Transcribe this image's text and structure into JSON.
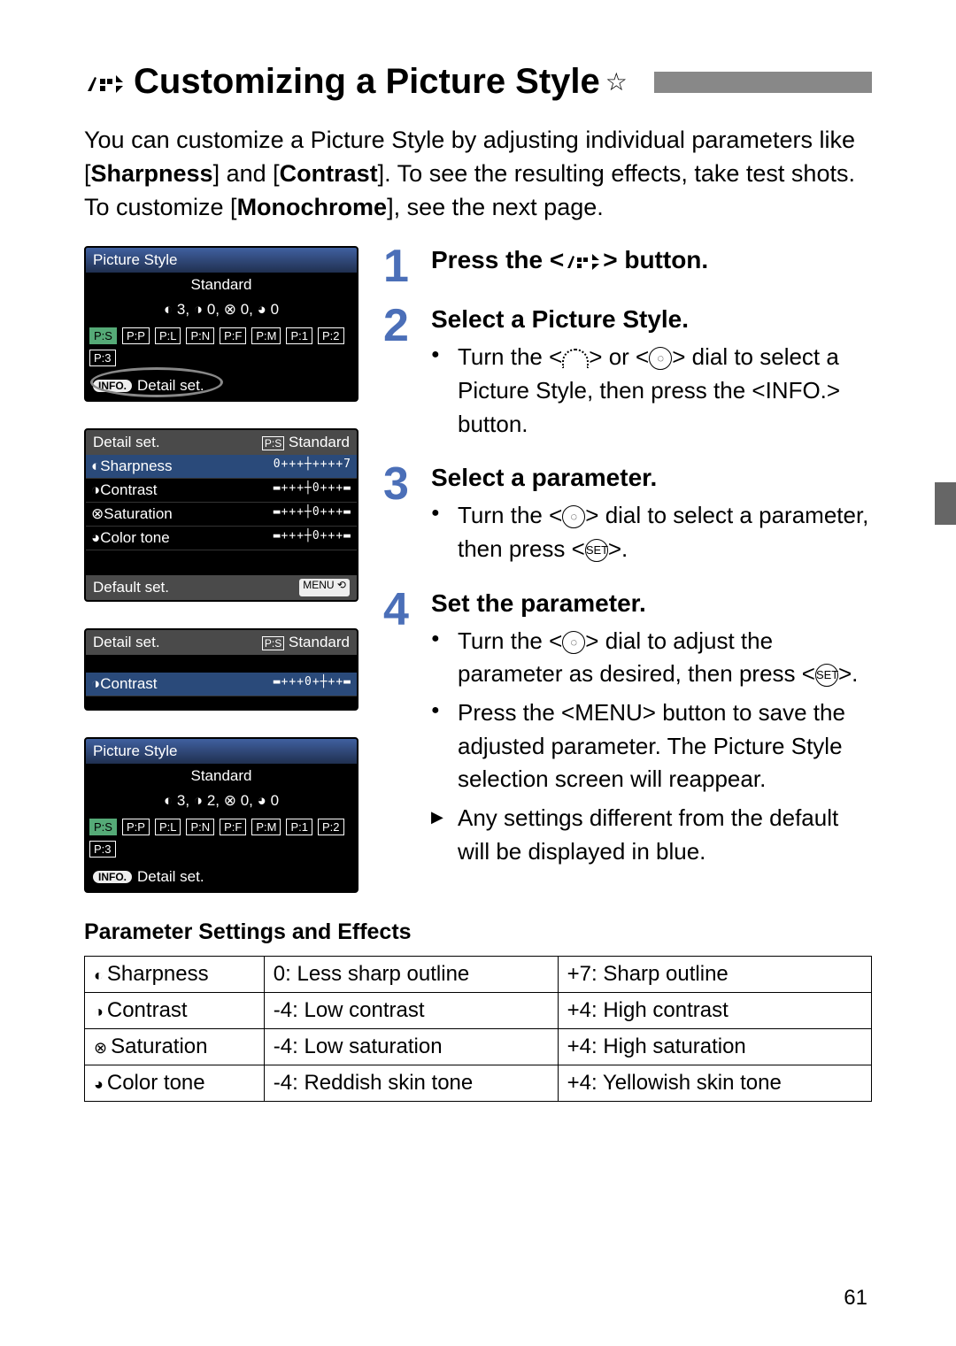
{
  "title": "Customizing a Picture Style",
  "star": "☆",
  "intro_parts": [
    "You can customize a Picture Style by adjusting individual parameters like [",
    "Sharpness",
    "] and [",
    "Contrast",
    "]. To see the resulting effects, take test shots. To customize [",
    "Monochrome",
    "], see the next page."
  ],
  "steps": [
    {
      "num": "1",
      "title_pre": "Press the <",
      "title_post": "> button.",
      "items": []
    },
    {
      "num": "2",
      "title": "Select a Picture Style.",
      "items": [
        {
          "kind": "bullet",
          "frags": [
            "Turn the <",
            "@DIAL",
            "> or <",
            "@CIRCLE",
            "> dial to select a Picture Style, then press the <",
            "INFO.",
            "> button."
          ]
        }
      ]
    },
    {
      "num": "3",
      "title": "Select a parameter.",
      "items": [
        {
          "kind": "bullet",
          "frags": [
            "Turn the <",
            "@CIRCLE",
            "> dial to select a parameter, then press <",
            "@SET",
            ">."
          ]
        }
      ]
    },
    {
      "num": "4",
      "title": "Set the parameter.",
      "items": [
        {
          "kind": "bullet",
          "frags": [
            "Turn the <",
            "@CIRCLE",
            "> dial to adjust the parameter as desired, then press <",
            "@SET",
            ">."
          ]
        },
        {
          "kind": "bullet",
          "frags": [
            "Press the <",
            "MENU",
            "> button to save the adjusted parameter. The Picture Style selection screen will reappear."
          ]
        },
        {
          "kind": "tri",
          "frags": [
            "Any settings different from the default will be displayed in blue."
          ]
        }
      ]
    }
  ],
  "lcd1": {
    "title": "Picture Style",
    "subtitle": "Standard",
    "readout": "◐ 3, ◑ 0, ⊗ 0, ◕ 0",
    "chips": [
      "P:S",
      "P:P",
      "P:L",
      "P:N",
      "P:F",
      "P:M",
      "P:1",
      "P:2",
      "P:3"
    ],
    "footer_info": "INFO.",
    "footer_text": "Detail set."
  },
  "lcd2": {
    "hdr_left": "Detail set.",
    "hdr_right": "P:S Standard",
    "rows": [
      {
        "label": "◐Sharpness",
        "slider": "0+++┼++++7",
        "sel": true
      },
      {
        "label": "◑Contrast",
        "slider": "▬+++┼0+++▬"
      },
      {
        "label": "⊗Saturation",
        "slider": "▬+++┼0+++▬"
      },
      {
        "label": "◕Color tone",
        "slider": "▬+++┼0+++▬"
      }
    ],
    "default": "Default set.",
    "menu": "MENU ⟲"
  },
  "lcd3": {
    "hdr_left": "Detail set.",
    "hdr_right": "P:S Standard",
    "row": {
      "label": "◑Contrast",
      "slider": "▬+++0+┼++▬"
    }
  },
  "lcd4": {
    "title": "Picture Style",
    "subtitle": "Standard",
    "readout": "◐ 3, ◑ 2, ⊗ 0, ◕ 0",
    "chips": [
      "P:S",
      "P:P",
      "P:L",
      "P:N",
      "P:F",
      "P:M",
      "P:1",
      "P:2",
      "P:3"
    ],
    "footer_info": "INFO.",
    "footer_text": "Detail set."
  },
  "table_title": "Parameter Settings and Effects",
  "table": [
    {
      "icon": "◐",
      "name": "Sharpness",
      "low": "0: Less sharp outline",
      "high": "+7: Sharp outline"
    },
    {
      "icon": "◑",
      "name": "Contrast",
      "low": "-4: Low contrast",
      "high": "+4: High contrast"
    },
    {
      "icon": "⊗",
      "name": "Saturation",
      "low": "-4: Low saturation",
      "high": "+4: High saturation"
    },
    {
      "icon": "◕",
      "name": "Color tone",
      "low": "-4: Reddish skin tone",
      "high": "+4: Yellowish skin tone"
    }
  ],
  "page": "61"
}
